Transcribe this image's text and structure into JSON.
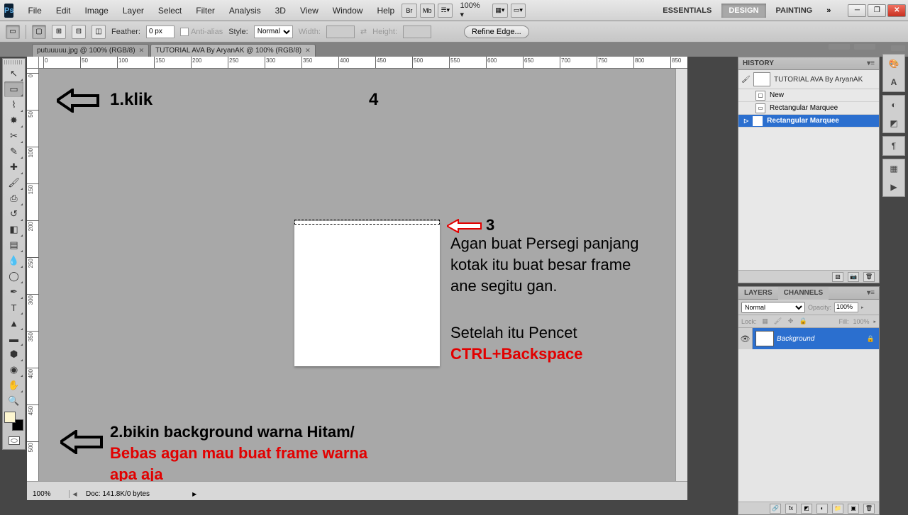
{
  "app": {
    "logo": "Ps"
  },
  "menu": [
    "File",
    "Edit",
    "Image",
    "Layer",
    "Select",
    "Filter",
    "Analysis",
    "3D",
    "View",
    "Window",
    "Help"
  ],
  "menubar_right": {
    "zoom": "100%",
    "workspaces": [
      "ESSENTIALS",
      "DESIGN",
      "PAINTING"
    ],
    "active_workspace": "DESIGN",
    "expand": "»"
  },
  "options": {
    "feather_label": "Feather:",
    "feather_value": "0 px",
    "antialias": "Anti-alias",
    "style_label": "Style:",
    "style_value": "Normal",
    "width_label": "Width:",
    "height_label": "Height:",
    "refine": "Refine Edge..."
  },
  "doctabs": [
    {
      "label": "putuuuuu.jpg @ 100% (RGB/8)",
      "active": false
    },
    {
      "label": "TUTORIAL AVA By AryanAK @ 100% (RGB/8)",
      "active": true
    }
  ],
  "status": {
    "zoom": "100%",
    "doc": "Doc: 141.8K/0 bytes"
  },
  "annotations": {
    "a1": "1.klik",
    "a4": "4",
    "a3": "3",
    "para1a": "Agan buat Persegi panjang",
    "para1b": "kotak itu buat besar frame",
    "para1c": "ane segitu gan.",
    "para2a": "Setelah itu Pencet",
    "para2b": "CTRL+Backspace",
    "a2a": "2.bikin background warna Hitam/",
    "a2b": "Bebas agan mau buat frame warna",
    "a2c": "apa aja"
  },
  "history": {
    "title": "HISTORY",
    "doc": "TUTORIAL AVA By AryanAK",
    "items": [
      {
        "label": "New",
        "selected": false,
        "icon": ""
      },
      {
        "label": "Rectangular Marquee",
        "selected": false,
        "icon": "▭"
      },
      {
        "label": "Rectangular Marquee",
        "selected": true,
        "icon": "▭"
      }
    ]
  },
  "layers": {
    "tabs": [
      "LAYERS",
      "CHANNELS"
    ],
    "blend": "Normal",
    "opacity_label": "Opacity:",
    "opacity": "100%",
    "lock_label": "Lock:",
    "fill_label": "Fill:",
    "fill": "100%",
    "layer": {
      "name": "Background"
    }
  },
  "ruler_h": [
    0,
    50,
    100,
    150,
    200,
    250,
    300,
    350,
    400,
    450,
    500,
    550,
    600,
    650,
    700,
    750,
    800,
    850
  ],
  "ruler_v": [
    0,
    50,
    100,
    150,
    200,
    250,
    300,
    350,
    400,
    450,
    500
  ]
}
